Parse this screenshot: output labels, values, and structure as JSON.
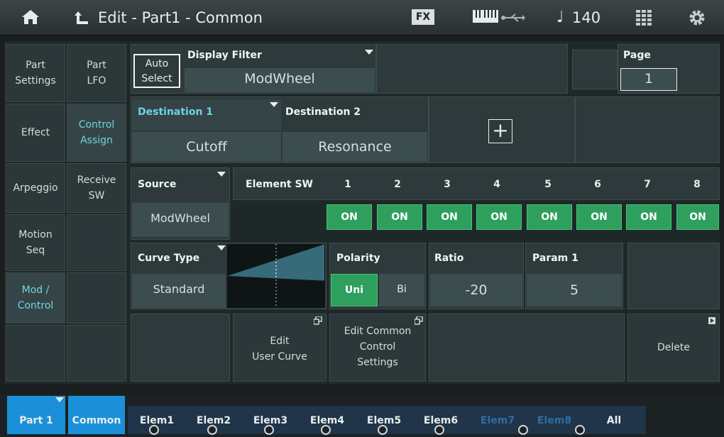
{
  "header": {
    "title": "Edit - Part1 - Common",
    "fx_label": "FX",
    "tempo_note": "♩",
    "tempo_value": "140"
  },
  "left_tabs_col1": [
    "Part\nSettings",
    "Effect",
    "Arpeggio",
    "Motion\nSeq",
    "Mod /\nControl"
  ],
  "left_tabs_col2": [
    "Part\nLFO",
    "Control\nAssign",
    "Receive\nSW"
  ],
  "auto_select": "Auto\nSelect",
  "display_filter": {
    "label": "Display Filter",
    "value": "ModWheel"
  },
  "page": {
    "label": "Page",
    "value": "1"
  },
  "destination1": {
    "label": "Destination 1",
    "value": "Cutoff"
  },
  "destination2": {
    "label": "Destination 2",
    "value": "Resonance"
  },
  "add_symbol": "+",
  "source": {
    "label": "Source",
    "value": "ModWheel"
  },
  "element_sw": {
    "label": "Element SW",
    "numbers": [
      "1",
      "2",
      "3",
      "4",
      "5",
      "6",
      "7",
      "8"
    ],
    "states": [
      "ON",
      "ON",
      "ON",
      "ON",
      "ON",
      "ON",
      "ON",
      "ON"
    ]
  },
  "curve_type": {
    "label": "Curve Type",
    "value": "Standard"
  },
  "polarity": {
    "label": "Polarity",
    "options": [
      "Uni",
      "Bi"
    ],
    "selected": "Uni"
  },
  "ratio": {
    "label": "Ratio",
    "value": "-20"
  },
  "param1": {
    "label": "Param 1",
    "value": "5"
  },
  "buttons": {
    "edit_user_curve": "Edit\nUser Curve",
    "edit_common_control": "Edit Common\nControl\nSettings",
    "delete": "Delete"
  },
  "bottom": {
    "part": "Part 1",
    "common": "Common",
    "elements": [
      "Elem1",
      "Elem2",
      "Elem3",
      "Elem4",
      "Elem5",
      "Elem6",
      "Elem7",
      "Elem8"
    ],
    "all": "All"
  },
  "colors": {
    "accent": "#6fd3e4",
    "on_green": "#2e9f5c",
    "part_blue": "#1b90d8"
  }
}
